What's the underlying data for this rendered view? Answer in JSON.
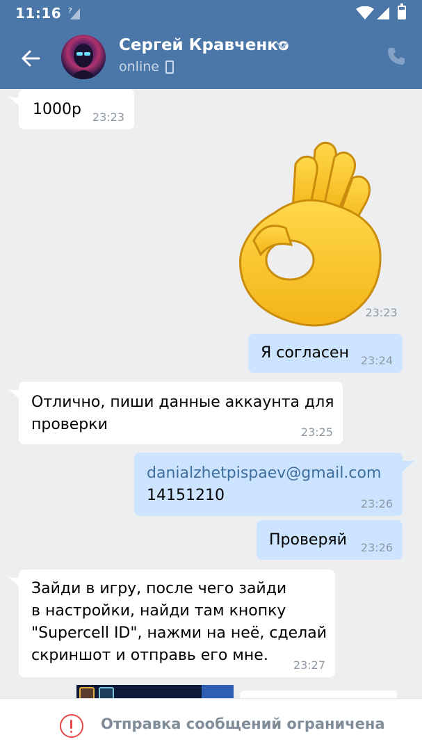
{
  "status_bar": {
    "time": "11:16",
    "icons": [
      "no-sim-icon",
      "wifi-icon",
      "cell-signal-icon",
      "battery-icon"
    ]
  },
  "header": {
    "contact_name": "Сергей Кравченко",
    "status": "online",
    "icons": [
      "back-arrow-icon",
      "avatar",
      "chevron-down-icon",
      "mobile-device-icon",
      "phone-call-icon"
    ],
    "accent_color": "#4a76a8"
  },
  "messages": [
    {
      "direction": "in",
      "text": "1000р",
      "time": "23:23"
    },
    {
      "direction": "out",
      "type": "sticker",
      "sticker": "ok-hand-emoji",
      "time": "23:23"
    },
    {
      "direction": "out",
      "text": "Я согласен",
      "time": "23:24"
    },
    {
      "direction": "in",
      "lines": [
        "Отлично, пиши данные аккаунта для",
        "проверки"
      ],
      "time": "23:25"
    },
    {
      "direction": "out",
      "lines": [
        "danialzhetpispaev@gmail.com",
        "14151210"
      ],
      "time": "23:26"
    },
    {
      "direction": "out",
      "text": "Проверяй",
      "time": "23:26"
    },
    {
      "direction": "in",
      "lines": [
        "Зайди в игру, после чего зайди",
        "в настройки, найди там кнопку",
        "\"Supercell ID\", нажми на неё, сделай",
        "скриншот и отправь его мне."
      ],
      "time": "23:27"
    }
  ],
  "colors": {
    "incoming_bubble": "#ffffff",
    "outgoing_bubble": "#cce4ff",
    "background": "#edeef0",
    "link": "#3f6f9e",
    "warning": "#e64646"
  },
  "bottom_bar": {
    "text": "Отправка сообщений ограничена",
    "icon": "warning-circle-icon"
  }
}
